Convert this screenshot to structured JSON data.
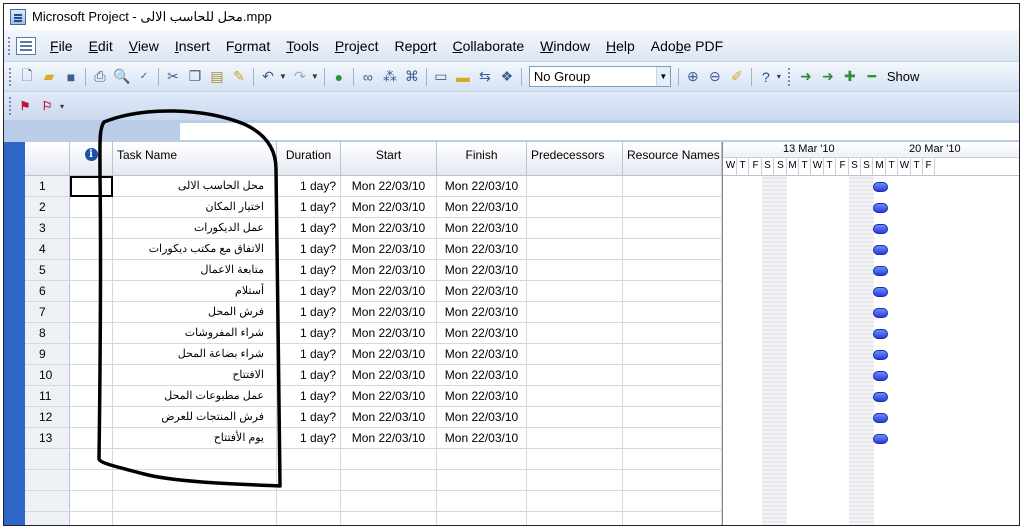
{
  "window": {
    "title": "Microsoft Project - محل للحاسب الالى.mpp"
  },
  "menu": [
    {
      "label": "File",
      "u": "F",
      "rest": "ile"
    },
    {
      "label": "Edit",
      "u": "E",
      "rest": "dit"
    },
    {
      "label": "View",
      "u": "V",
      "rest": "iew"
    },
    {
      "label": "Insert",
      "u": "I",
      "rest": "nsert"
    },
    {
      "label": "Format",
      "pre": "F",
      "u": "o",
      "rest": "rmat"
    },
    {
      "label": "Tools",
      "u": "T",
      "rest": "ools"
    },
    {
      "label": "Project",
      "u": "P",
      "rest": "roject"
    },
    {
      "label": "Report",
      "pre": "Rep",
      "u": "o",
      "rest": "rt"
    },
    {
      "label": "Collaborate",
      "u": "C",
      "rest": "ollaborate"
    },
    {
      "label": "Window",
      "u": "W",
      "rest": "indow"
    },
    {
      "label": "Help",
      "u": "H",
      "rest": "elp"
    },
    {
      "label": "Adobe PDF",
      "pre": "Ado",
      "u": "b",
      "rest": "e PDF"
    }
  ],
  "toolbar": {
    "group_value": "No Group",
    "show_label": "Show"
  },
  "table": {
    "columns": {
      "task_name": "Task Name",
      "duration": "Duration",
      "start": "Start",
      "finish": "Finish",
      "predecessors": "Predecessors",
      "resource_names": "Resource Names"
    },
    "rows": [
      {
        "id": "1",
        "name": "محل الحاسب الالى",
        "duration": "1 day?",
        "start": "Mon 22/03/10",
        "finish": "Mon 22/03/10"
      },
      {
        "id": "2",
        "name": "اختيار المكان",
        "duration": "1 day?",
        "start": "Mon 22/03/10",
        "finish": "Mon 22/03/10"
      },
      {
        "id": "3",
        "name": "عمل الديكورات",
        "duration": "1 day?",
        "start": "Mon 22/03/10",
        "finish": "Mon 22/03/10"
      },
      {
        "id": "4",
        "name": "الاتفاق مع مكتب ديكورات",
        "duration": "1 day?",
        "start": "Mon 22/03/10",
        "finish": "Mon 22/03/10"
      },
      {
        "id": "5",
        "name": "متابعة الاعمال",
        "duration": "1 day?",
        "start": "Mon 22/03/10",
        "finish": "Mon 22/03/10"
      },
      {
        "id": "6",
        "name": "أستلام",
        "duration": "1 day?",
        "start": "Mon 22/03/10",
        "finish": "Mon 22/03/10"
      },
      {
        "id": "7",
        "name": "فرش المحل",
        "duration": "1 day?",
        "start": "Mon 22/03/10",
        "finish": "Mon 22/03/10"
      },
      {
        "id": "8",
        "name": "شراء المفروشات",
        "duration": "1 day?",
        "start": "Mon 22/03/10",
        "finish": "Mon 22/03/10"
      },
      {
        "id": "9",
        "name": "شراء بضاعة المحل",
        "duration": "1 day?",
        "start": "Mon 22/03/10",
        "finish": "Mon 22/03/10"
      },
      {
        "id": "10",
        "name": "الافتتاح",
        "duration": "1 day?",
        "start": "Mon 22/03/10",
        "finish": "Mon 22/03/10"
      },
      {
        "id": "11",
        "name": "عمل مطبوعات المحل",
        "duration": "1 day?",
        "start": "Mon 22/03/10",
        "finish": "Mon 22/03/10"
      },
      {
        "id": "12",
        "name": "فرش المنتجات للعرض",
        "duration": "1 day?",
        "start": "Mon 22/03/10",
        "finish": "Mon 22/03/10"
      },
      {
        "id": "13",
        "name": "يوم الأفتتاح",
        "duration": "1 day?",
        "start": "Mon 22/03/10",
        "finish": "Mon 22/03/10"
      }
    ],
    "empty_rows": 4
  },
  "gantt": {
    "weeks": [
      "13 Mar '10",
      "20 Mar '10"
    ],
    "days": [
      "W",
      "T",
      "F",
      "S",
      "S",
      "M",
      "T",
      "W",
      "T",
      "F",
      "S",
      "S",
      "M",
      "T",
      "W",
      "T",
      "F"
    ],
    "task_day": "M",
    "colors": {
      "bar": "#2a3fd6",
      "view_bar": "#2f67c9"
    }
  }
}
